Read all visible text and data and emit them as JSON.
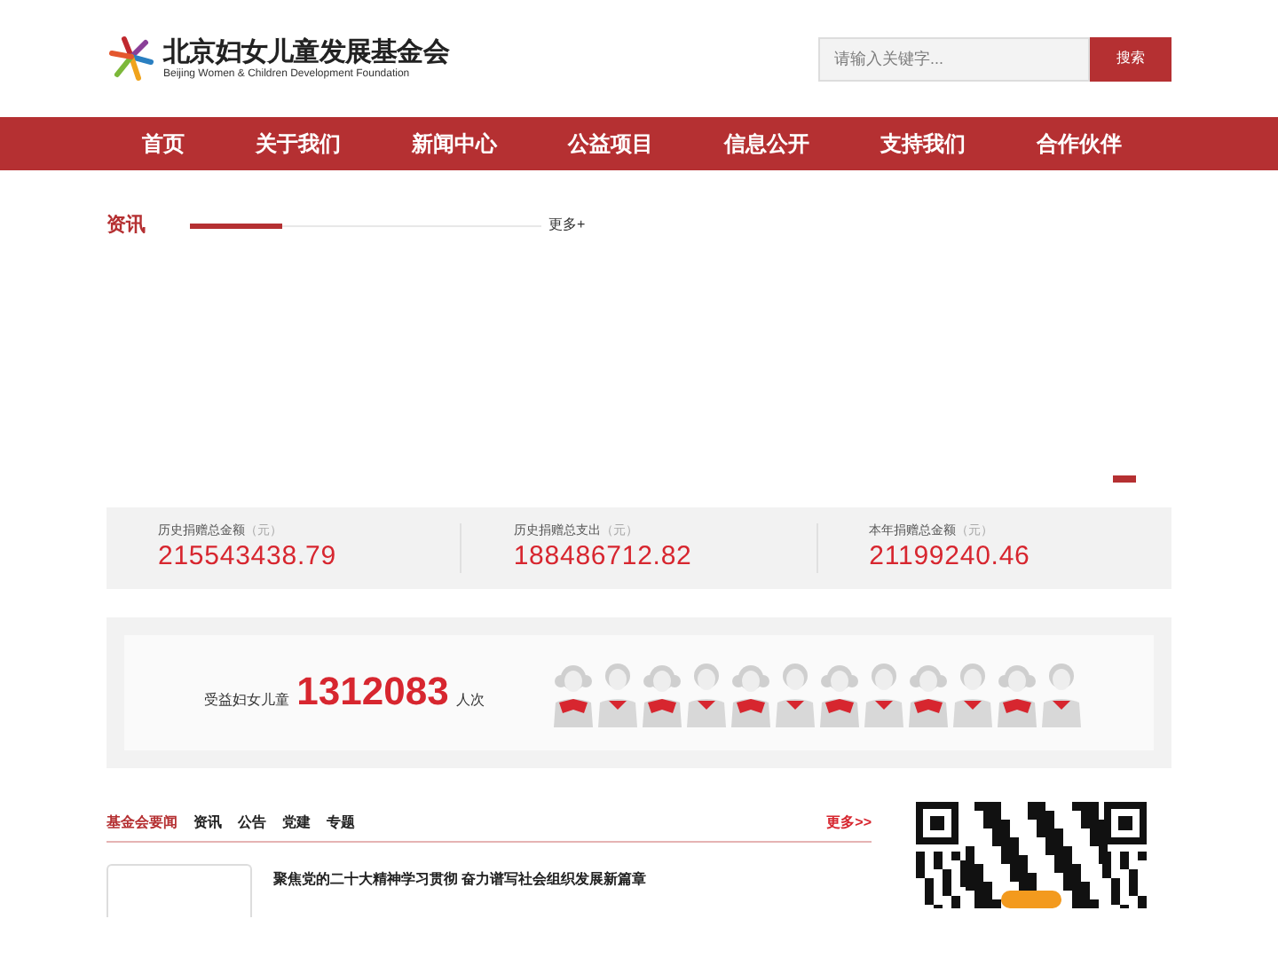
{
  "header": {
    "logo_title": "北京妇女儿童发展基金会",
    "logo_subtitle": "Beijing Women & Children Development Foundation",
    "search": {
      "placeholder": "请输入关键字...",
      "button": "搜索"
    }
  },
  "nav": [
    "首页",
    "关于我们",
    "新闻中心",
    "公益项目",
    "信息公开",
    "支持我们",
    "合作伙伴"
  ],
  "news_section": {
    "title": "资讯",
    "more": "更多+"
  },
  "carousel": {
    "indicators": [
      {
        "selected": true
      }
    ]
  },
  "stats": [
    {
      "label": "历史捐赠总金额",
      "unit": "（元）",
      "value": "215543438.79"
    },
    {
      "label": "历史捐赠总支出",
      "unit": "（元）",
      "value": "188486712.82"
    },
    {
      "label": "本年捐赠总金额",
      "unit": "（元）",
      "value": "21199240.46"
    }
  ],
  "beneficiaries": {
    "label": "受益妇女儿童",
    "count": "1312083",
    "unit": "人次",
    "figures": [
      {
        "kind": "girl"
      },
      {
        "kind": "boy"
      },
      {
        "kind": "girl"
      },
      {
        "kind": "boy"
      },
      {
        "kind": "girl"
      },
      {
        "kind": "boy"
      },
      {
        "kind": "girl"
      },
      {
        "kind": "boy"
      },
      {
        "kind": "girl"
      },
      {
        "kind": "boy"
      },
      {
        "kind": "girl"
      },
      {
        "kind": "boy"
      }
    ]
  },
  "news_tabs": {
    "tabs": [
      {
        "label": "基金会要闻",
        "selected": true
      },
      {
        "label": "资讯",
        "selected": false
      },
      {
        "label": "公告",
        "selected": false
      },
      {
        "label": "党建",
        "selected": false
      },
      {
        "label": "专题",
        "selected": false
      }
    ],
    "more": "更多>>"
  },
  "news_items": [
    {
      "title": "聚焦党的二十大精神学习贯彻 奋力谱写社会组织发展新篇章"
    }
  ]
}
